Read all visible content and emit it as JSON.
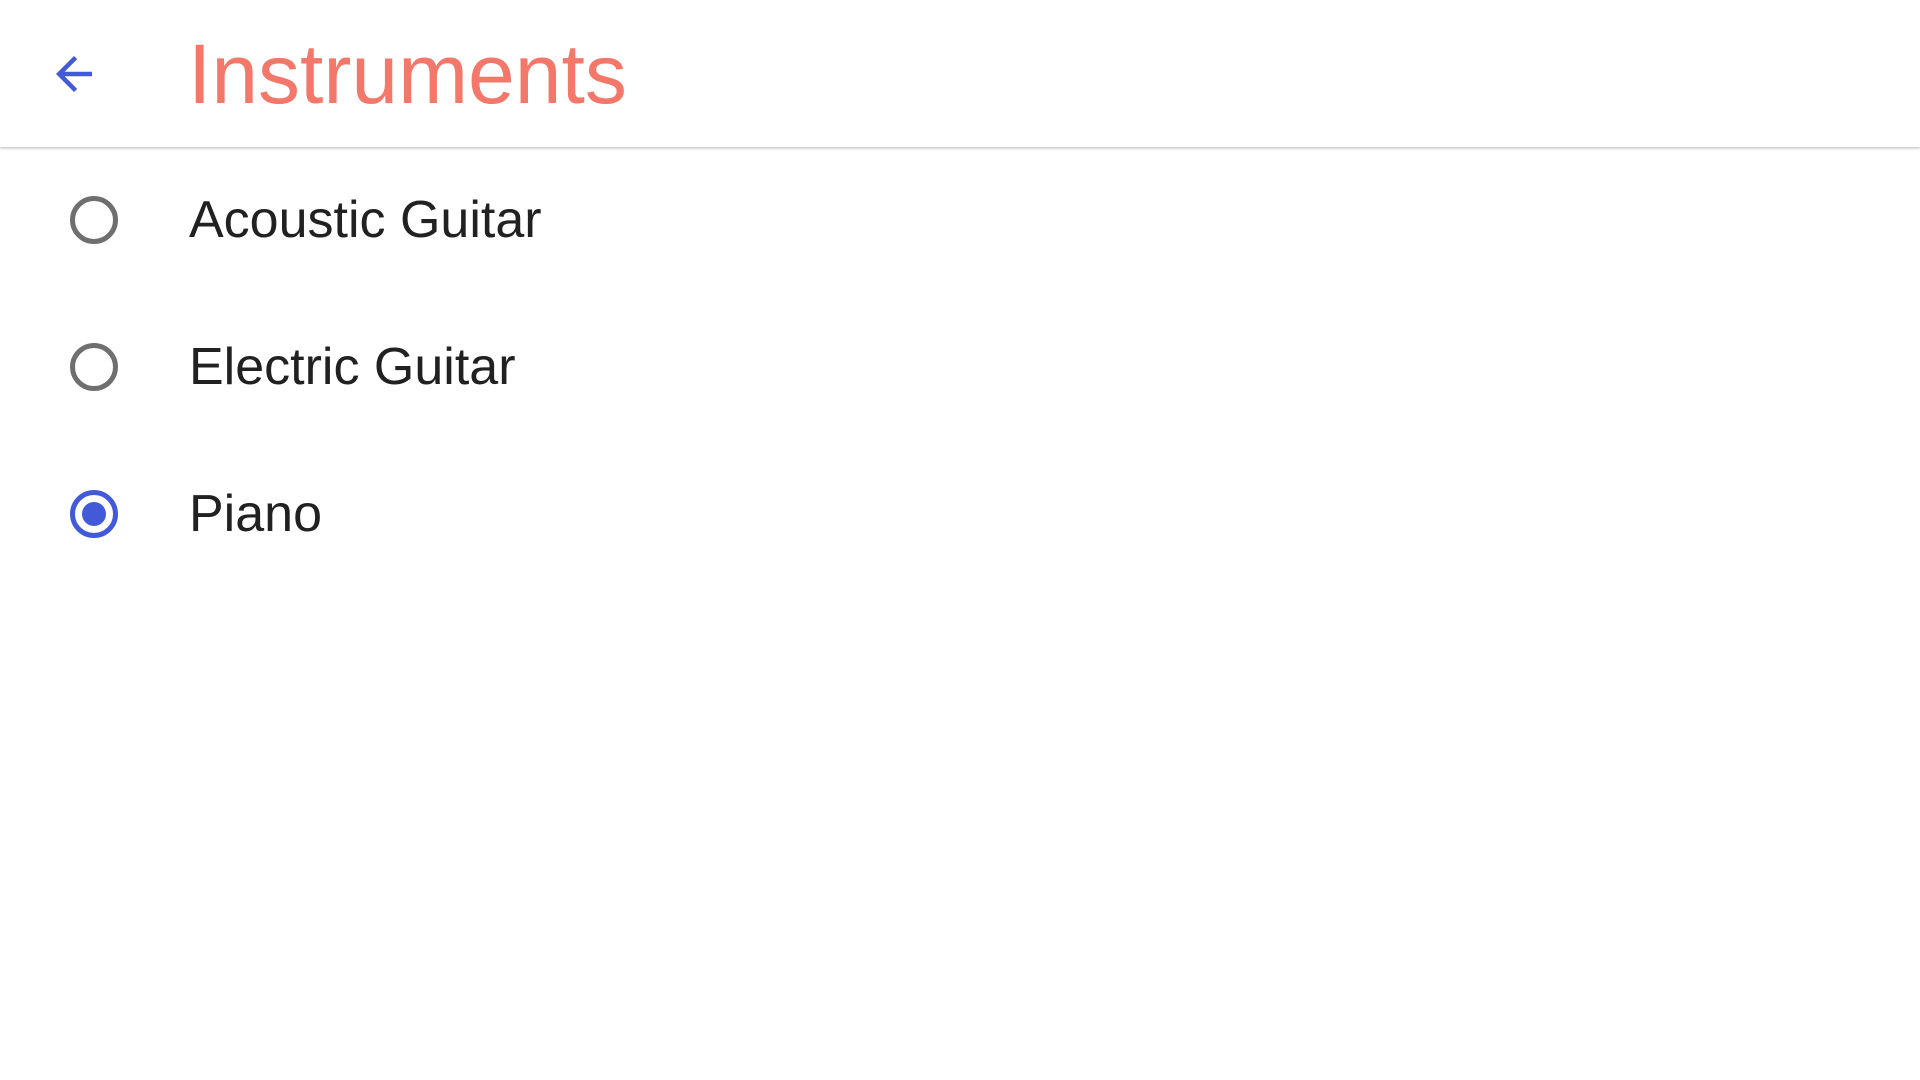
{
  "colors": {
    "accent": "#4259d8",
    "title": "#f4786a",
    "radio_unchecked": "#6f6f6f",
    "label": "#212121"
  },
  "header": {
    "back_icon": "arrow-back-icon",
    "title": "Instruments"
  },
  "options": [
    {
      "label": "Acoustic Guitar",
      "selected": false
    },
    {
      "label": "Electric Guitar",
      "selected": false
    },
    {
      "label": "Piano",
      "selected": true
    }
  ]
}
